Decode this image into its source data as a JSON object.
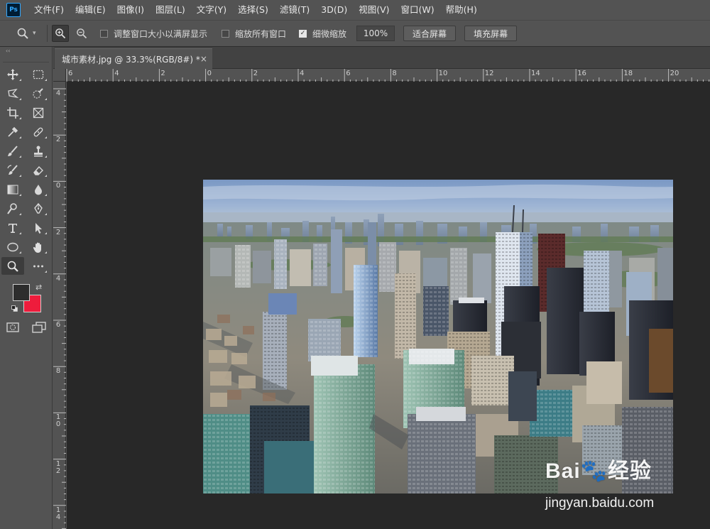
{
  "app": {
    "logo_text": "Ps"
  },
  "menu": {
    "items": [
      "文件(F)",
      "编辑(E)",
      "图像(I)",
      "图层(L)",
      "文字(Y)",
      "选择(S)",
      "滤镜(T)",
      "3D(D)",
      "视图(V)",
      "窗口(W)",
      "帮助(H)"
    ]
  },
  "options": {
    "resize_windows_label": "调整窗口大小以满屏显示",
    "resize_windows_checked": false,
    "zoom_all_label": "缩放所有窗口",
    "zoom_all_checked": false,
    "scrubby_zoom_label": "细微缩放",
    "scrubby_zoom_checked": true,
    "zoom_value": "100%",
    "fit_screen_label": "适合屏幕",
    "fill_screen_label": "填充屏幕"
  },
  "document": {
    "tab_title": "城市素材.jpg @ 33.3%(RGB/8#) *",
    "close_glyph": "×"
  },
  "rulers": {
    "top_labels": [
      "6",
      "4",
      "2",
      "0",
      "2",
      "4",
      "6",
      "8",
      "10",
      "12",
      "14",
      "16",
      "18",
      "20"
    ],
    "left_labels": [
      "4",
      "2",
      "0",
      "2",
      "4",
      "6",
      "8",
      "10",
      "12",
      "14"
    ]
  },
  "tools": {
    "active": "zoom-tool",
    "foreground_color": "#2d2d2d",
    "background_color": "#ee1c3c"
  },
  "watermark": {
    "logo_text": "Bai🐾经验",
    "url": "jingyan.baidu.com"
  },
  "colors": {
    "menubar_bg": "#535353",
    "workspace_bg": "#282828"
  }
}
